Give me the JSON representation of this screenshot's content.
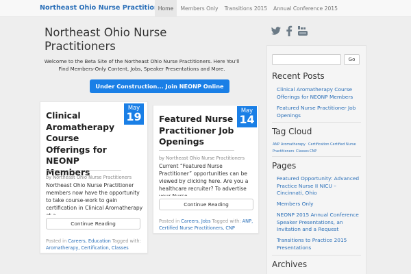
{
  "navbar": {
    "brand": "Northeast Ohio Nurse Practitioners",
    "items": [
      "Home",
      "Members Only",
      "Transitions 2015",
      "Annual Conference 2015"
    ]
  },
  "header": {
    "title": "Northeast Ohio Nurse Practitioners",
    "welcome": "Welcome to the Beta Site of the Northeast Ohio Nurse Practitioners. Here You'll Find Members-Only Content, Jobs, Speaker Presentations and More.",
    "cta": "Under Construction... Join NEONP Online"
  },
  "posts": [
    {
      "title": "Clinical Aromatherapy Course Offerings for NEONP Members",
      "month": "May",
      "day": "19",
      "byline": "by Northeast Ohio Nurse Practitioners",
      "excerpt": "Northeast Ohio Nurse Practitioner members now have the opportunity to take course-work to gain certification in Clinical Aromatherapy at a",
      "read_more": "Continue Reading",
      "posted_in": "Posted in",
      "categories": "Careers, Education",
      "tagged_with": "Tagged with:",
      "tags": "Aromatherapy, Certification, Classes"
    },
    {
      "title": "Featured Nurse Practitioner Job Openings",
      "month": "May",
      "day": "14",
      "byline": "by Northeast Ohio Nurse Practitioners",
      "excerpt": "Current “Featured Nurse Practitioner” opportunities can be viewed by clicking here. Are you a healthcare recruiter?  To advertise your Nurse",
      "read_more": "Continue Reading",
      "posted_in": "Posted in",
      "categories": "Careers, Jobs",
      "tagged_with": "Tagged with:",
      "tags": "ANP, Certified Nurse Practitioners, CNP"
    }
  ],
  "sidebar": {
    "social_icons": [
      "twitter-icon",
      "facebook-icon",
      "youtube-icon"
    ],
    "search_placeholder": "",
    "search_button": "Go",
    "recent_posts_heading": "Recent Posts",
    "recent_posts": [
      "Clinical Aromatherapy Course Offerings for NEONP Members",
      "Featured Nurse Practitioner Job Openings"
    ],
    "tag_cloud_heading": "Tag Cloud",
    "tags": [
      "ANP",
      "Aromatherapy",
      "Certification",
      "Certified Nurse Practitioners",
      "Classes",
      "CNP"
    ],
    "pages_heading": "Pages",
    "pages": [
      "Featured Opportunity: Advanced Practice Nurse II NICU – Cincinnati, Ohio",
      "Members Only",
      "NEONP 2015 Annual Conference Speaker Presentations, an Invitation and a Request",
      "Transitions to Practice 2015 Presentations"
    ],
    "archives_heading": "Archives"
  },
  "colors": {
    "accent": "#1a7fe6",
    "link": "#2a6fb8",
    "background": "#eeeeee"
  }
}
